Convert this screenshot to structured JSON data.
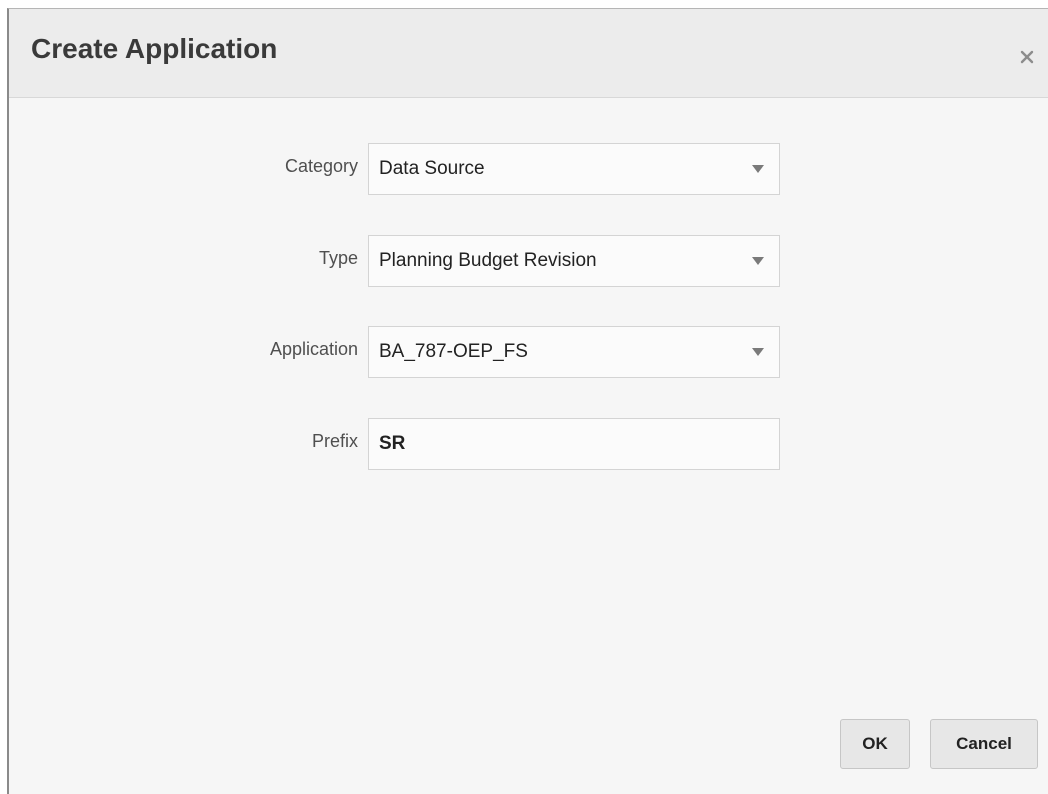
{
  "dialog": {
    "title": "Create Application",
    "close_icon": "close-icon"
  },
  "form": {
    "category": {
      "label": "Category",
      "value": "Data Source"
    },
    "type": {
      "label": "Type",
      "value": "Planning Budget Revision"
    },
    "application": {
      "label": "Application",
      "value": "BA_787-OEP_FS"
    },
    "prefix": {
      "label": "Prefix",
      "value": "SR"
    }
  },
  "buttons": {
    "ok_label": "OK",
    "cancel_label": "Cancel"
  },
  "icons": {
    "dropdown": "chevron-down-icon"
  }
}
